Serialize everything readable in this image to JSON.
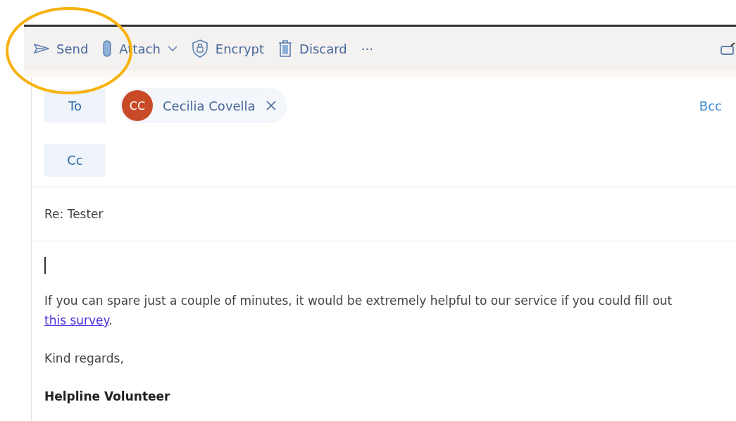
{
  "toolbar": {
    "items": [
      {
        "kind": "send",
        "label": "Send"
      },
      {
        "kind": "attach",
        "label": "Attach"
      },
      {
        "kind": "encrypt",
        "label": "Encrypt"
      },
      {
        "kind": "discard",
        "label": "Discard"
      },
      {
        "kind": "more",
        "label": "···"
      }
    ]
  },
  "recipients": {
    "to_label": "To",
    "to": [
      {
        "initials": "CC",
        "name": "Cecilia Covella",
        "color": "#c94a27"
      }
    ],
    "bcc_label": "Bcc",
    "cc_label": "Cc"
  },
  "subject": "Re: Tester",
  "body": {
    "paragraphs": [
      {
        "before": "If you can spare just a couple of minutes, it would be extremely helpful to our service if you could fill out ",
        "link": "this survey",
        "after": "."
      }
    ],
    "closing": "Kind regards,",
    "signature": "Helpline Volunteer"
  },
  "annotation": {
    "kind": "ellipse",
    "color": "#f7b20d"
  }
}
